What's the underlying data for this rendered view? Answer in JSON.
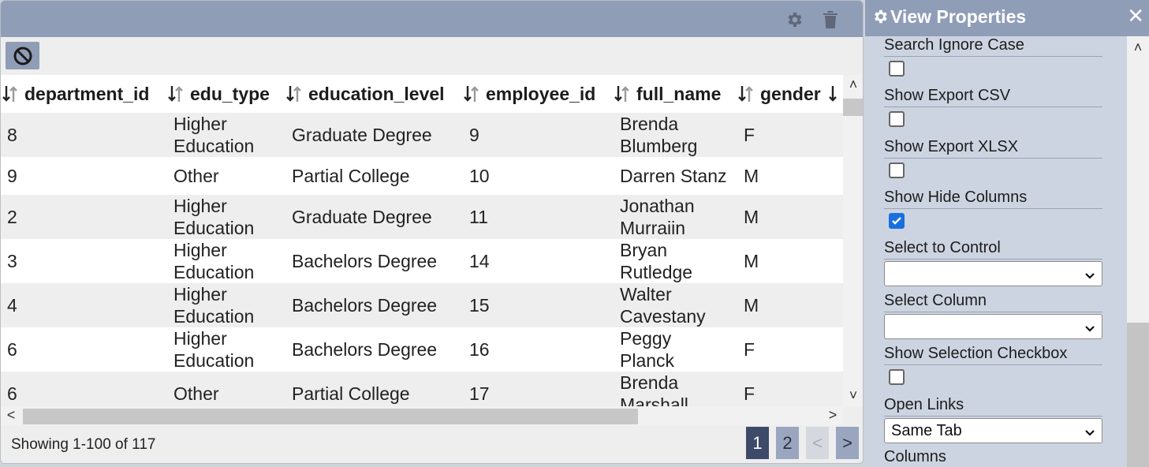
{
  "table": {
    "columns": [
      {
        "label": "department_id"
      },
      {
        "label": "edu_type"
      },
      {
        "label": "education_level"
      },
      {
        "label": "employee_id"
      },
      {
        "label": "full_name"
      },
      {
        "label": "gender"
      }
    ],
    "rows": [
      [
        "8",
        "Higher\nEducation",
        "Graduate Degree",
        "9",
        "Brenda\nBlumberg",
        "F"
      ],
      [
        "9",
        "Other",
        "Partial College",
        "10",
        "Darren Stanz",
        "M"
      ],
      [
        "2",
        "Higher\nEducation",
        "Graduate Degree",
        "11",
        "Jonathan\nMurraiin",
        "M"
      ],
      [
        "3",
        "Higher\nEducation",
        "Bachelors Degree",
        "14",
        "Bryan\nRutledge",
        "M"
      ],
      [
        "4",
        "Higher\nEducation",
        "Bachelors Degree",
        "15",
        "Walter\nCavestany",
        "M"
      ],
      [
        "6",
        "Higher\nEducation",
        "Bachelors Degree",
        "16",
        "Peggy\nPlanck",
        "F"
      ],
      [
        "6",
        "Other",
        "Partial College",
        "17",
        "Brenda\nMarshall",
        "F"
      ]
    ]
  },
  "footer": {
    "showing": "Showing 1-100 of 117",
    "pages": [
      "1",
      "2"
    ],
    "prev": "<",
    "next": ">"
  },
  "props": {
    "title": "View Properties",
    "close": "✕",
    "fields": [
      {
        "label": "Search Ignore Case",
        "type": "checkbox",
        "checked": false
      },
      {
        "label": "Show Export CSV",
        "type": "checkbox",
        "checked": false
      },
      {
        "label": "Show Export XLSX",
        "type": "checkbox",
        "checked": false
      },
      {
        "label": "Show Hide Columns",
        "type": "checkbox",
        "checked": true
      },
      {
        "label": "Select to Control",
        "type": "select",
        "value": ""
      },
      {
        "label": "Select Column",
        "type": "select",
        "value": ""
      },
      {
        "label": "Show Selection Checkbox",
        "type": "checkbox",
        "checked": false
      },
      {
        "label": "Open Links",
        "type": "select",
        "value": "Same Tab"
      },
      {
        "label": "Columns",
        "type": "label"
      }
    ]
  },
  "icons": {
    "settings": "gear-icon",
    "delete": "trash-icon",
    "clear": "ban-icon",
    "sort": "sort-icon"
  },
  "colors": {
    "header": "#8f9db7",
    "page_active": "#3d4a68",
    "page_inactive": "#9aa6bf",
    "check_accent": "#1a6fe0"
  }
}
